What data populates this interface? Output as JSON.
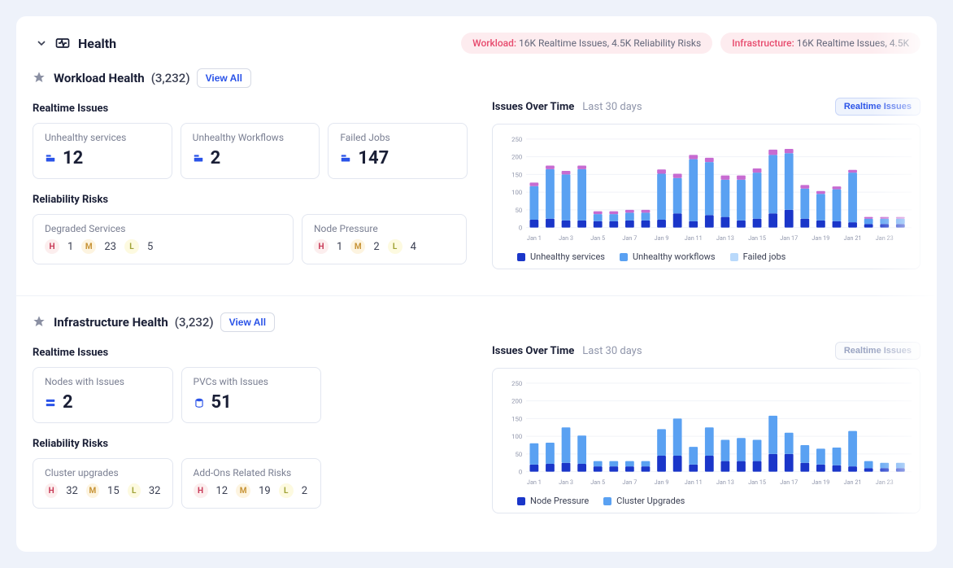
{
  "header": {
    "title": "Health",
    "pill1_label": "Workload:",
    "pill1_text": "16K Realtime Issues, 4.5K Reliability Risks",
    "pill2_label": "Infrastructure:",
    "pill2_text": "16K Realtime Issues, 4.5K"
  },
  "workload": {
    "title": "Workload Health",
    "count": "(3,232)",
    "view_all": "View All",
    "realtime_label": "Realtime Issues",
    "cards": {
      "unhealthy_services": {
        "title": "Unhealthy services",
        "value": "12"
      },
      "unhealthy_workflows": {
        "title": "Unhealthy Workflows",
        "value": "2"
      },
      "failed_jobs": {
        "title": "Failed Jobs",
        "value": "147"
      }
    },
    "reliability_label": "Reliability Risks",
    "risks": {
      "degraded": {
        "title": "Degraded Services",
        "h": "1",
        "m": "23",
        "l": "5"
      },
      "node_pressure": {
        "title": "Node Pressure",
        "h": "1",
        "m": "2",
        "l": "4"
      }
    },
    "chart_title": "Issues Over Time",
    "chart_sub": "Last 30 days",
    "chart_btn": "Realtime Issues",
    "legend": {
      "a": "Unhealthy services",
      "b": "Unhealthy workflows",
      "c": "Failed jobs"
    }
  },
  "infrastructure": {
    "title": "Infrastructure Health",
    "count": "(3,232)",
    "view_all": "View All",
    "realtime_label": "Realtime Issues",
    "cards": {
      "nodes": {
        "title": "Nodes with Issues",
        "value": "2"
      },
      "pvcs": {
        "title": "PVCs with Issues",
        "value": "51"
      }
    },
    "reliability_label": "Reliability Risks",
    "risks": {
      "upgrades": {
        "title": "Cluster upgrades",
        "h": "32",
        "m": "15",
        "l": "32"
      },
      "addons": {
        "title": "Add-Ons Related Risks",
        "h": "12",
        "m": "19",
        "l": "2"
      }
    },
    "chart_title": "Issues Over Time",
    "chart_sub": "Last 30 days",
    "chart_btn": "Realtime Issues",
    "legend": {
      "a": "Node Pressure",
      "b": "Cluster Upgrades"
    }
  },
  "chart_data": [
    {
      "type": "bar",
      "stacked": true,
      "ylim": [
        0,
        250
      ],
      "yticks": [
        0,
        50,
        100,
        150,
        200,
        250
      ],
      "categories": [
        "Jan 1",
        "",
        "Jan 3",
        "",
        "Jan 5",
        "",
        "Jan 7",
        "",
        "Jan 9",
        "",
        "Jan 11",
        "",
        "Jan 13",
        "",
        "Jan 15",
        "",
        "Jan 17",
        "",
        "Jan 19",
        "",
        "Jan 21",
        "",
        "Jan 23",
        ""
      ],
      "series": [
        {
          "name": "Unhealthy services",
          "color": "#1a36c9",
          "values": [
            22,
            25,
            20,
            20,
            18,
            18,
            20,
            20,
            22,
            40,
            18,
            35,
            30,
            20,
            25,
            40,
            50,
            25,
            20,
            18,
            15,
            10,
            10,
            10
          ]
        },
        {
          "name": "Unhealthy workflows",
          "color": "#5aa1f2",
          "values": [
            95,
            140,
            130,
            145,
            20,
            20,
            22,
            22,
            130,
            100,
            175,
            150,
            105,
            115,
            130,
            165,
            160,
            85,
            75,
            90,
            140,
            15,
            15,
            15
          ]
        },
        {
          "name": "Failed jobs",
          "color": "#c76bd1",
          "values": [
            10,
            10,
            10,
            10,
            8,
            8,
            8,
            8,
            12,
            12,
            12,
            12,
            12,
            12,
            12,
            15,
            12,
            10,
            8,
            8,
            8,
            5,
            5,
            5
          ]
        }
      ]
    },
    {
      "type": "bar",
      "stacked": true,
      "ylim": [
        0,
        250
      ],
      "yticks": [
        0,
        50,
        100,
        150,
        200,
        250
      ],
      "categories": [
        "Jan 1",
        "",
        "Jan 3",
        "",
        "Jan 5",
        "",
        "Jan 7",
        "",
        "Jan 9",
        "",
        "Jan 11",
        "",
        "Jan 13",
        "",
        "Jan 15",
        "",
        "Jan 17",
        "",
        "Jan 19",
        "",
        "Jan 21",
        "",
        "Jan 23",
        ""
      ],
      "series": [
        {
          "name": "Node Pressure",
          "color": "#1a36c9",
          "values": [
            20,
            22,
            25,
            22,
            15,
            15,
            15,
            15,
            45,
            45,
            20,
            45,
            30,
            30,
            30,
            50,
            50,
            25,
            20,
            18,
            15,
            10,
            10,
            10
          ]
        },
        {
          "name": "Cluster Upgrades",
          "color": "#5aa1f2",
          "values": [
            60,
            60,
            100,
            80,
            15,
            15,
            15,
            15,
            75,
            105,
            50,
            80,
            60,
            65,
            60,
            108,
            60,
            50,
            45,
            50,
            100,
            20,
            15,
            15
          ]
        }
      ]
    }
  ],
  "risk_letters": {
    "h": "H",
    "m": "M",
    "l": "L"
  }
}
